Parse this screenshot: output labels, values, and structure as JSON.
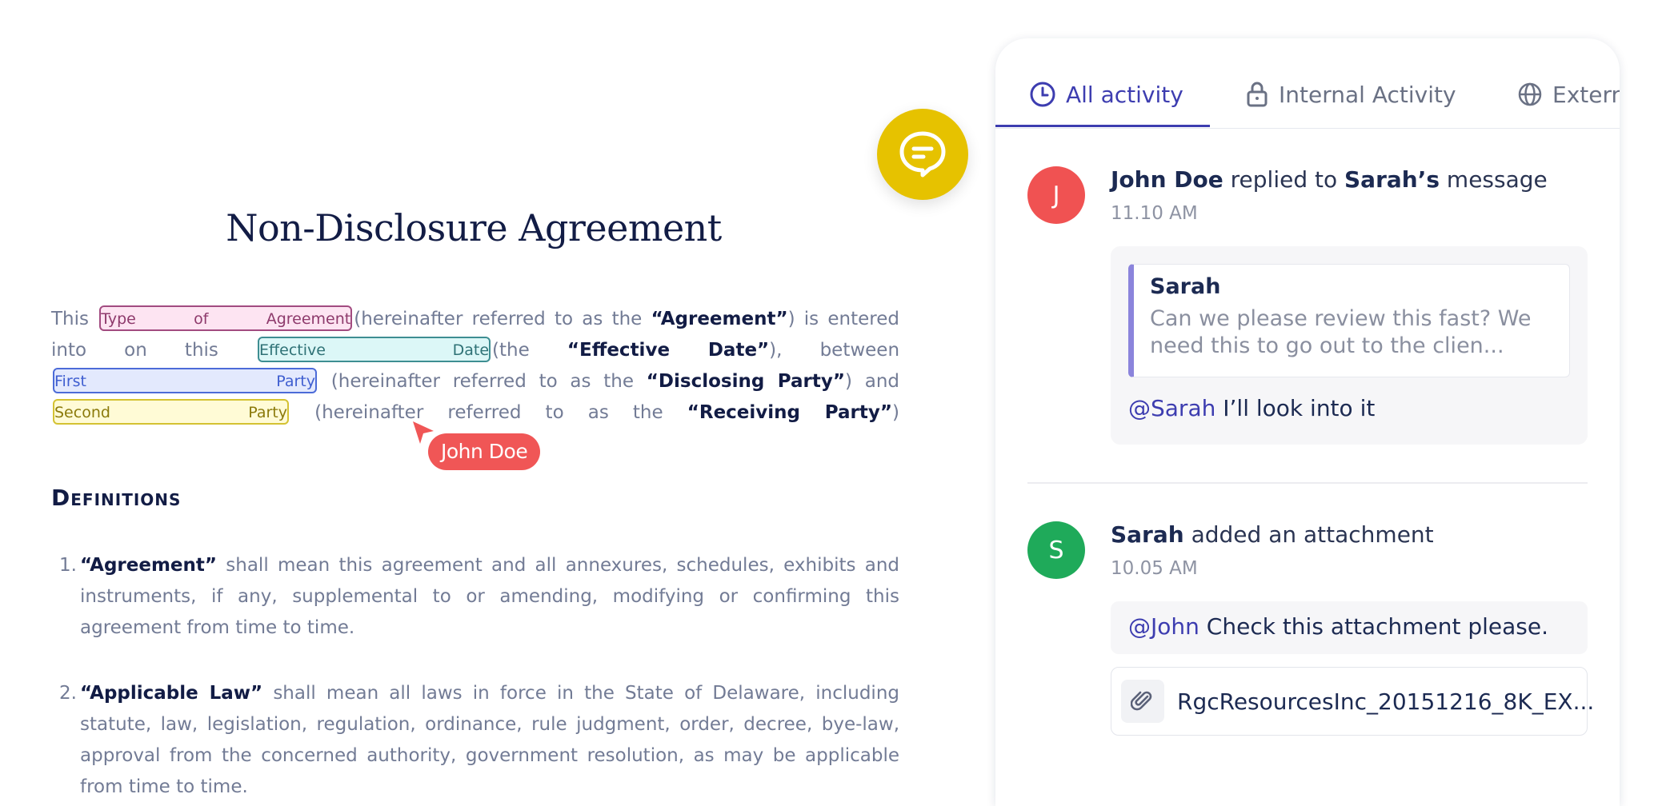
{
  "document": {
    "title": "Non-Disclosure Agreement",
    "intro": {
      "t1": "This",
      "field_type": "Type of Agreement",
      "t2": "(hereinafter referred to as the",
      "b_agreement": "“Agreement”",
      "t3": ") is entered into on this",
      "field_date": "Effective Date",
      "t4": "(the",
      "b_effective": "“Effective Date”",
      "t5": "), between",
      "field_first": "First Party",
      "t6": "(hereinafter referred to as the",
      "b_disclosing": "“Disclosing Party”",
      "t7": ") and",
      "field_second": "Second Party",
      "t8": "(hereinafter referred to as the",
      "b_receiving": "“Receiving Party”",
      "t9": ")"
    },
    "cursor": {
      "label": "John Doe",
      "color": "#f05656"
    },
    "definitions": {
      "heading": "Definitions",
      "items": [
        {
          "num": "1.",
          "term": "“Agreement”",
          "text": " shall mean this agreement and all annexures, schedules, exhibits and instruments, if any, supplemental to or amending, modifying or confirming this agreement from time to time."
        },
        {
          "num": "2.",
          "term": "“Applicable Law”",
          "text": " shall mean all laws in force in the State of Delaware, including statute, law, legislation, regulation, ordinance, rule judgment, order, decree, bye-law, approval from the concerned authority, government resolution, as may be applicable from time to time."
        }
      ]
    }
  },
  "chat_button": {
    "icon": "chat-bubble-icon",
    "color": "#e6c200"
  },
  "activity": {
    "tabs": [
      {
        "label": "All activity",
        "icon": "clock-icon",
        "active": true
      },
      {
        "label": "Internal Activity",
        "icon": "lock-icon"
      },
      {
        "label": "Extern",
        "icon": "globe-icon"
      }
    ],
    "items": [
      {
        "avatar": "J",
        "avatar_color": "#f05252",
        "actor": "John Doe",
        "action": " replied to ",
        "target": "Sarah’s",
        "suffix": " message",
        "time": "11.10 AM",
        "quote_author": "Sarah",
        "quote_text": "Can we please review this fast? We need this to go out to the clien...",
        "reply_mention": "@Sarah",
        "reply_text": " I’ll look into it"
      },
      {
        "avatar": "S",
        "avatar_color": "#1faa5a",
        "actor": "Sarah",
        "action": " added an attachment",
        "time": "10.05 AM",
        "msg_mention": "@John",
        "msg_text": " Check this attachment please.",
        "attachment_icon": "paperclip-icon",
        "attachment_name": "RgcResourcesInc_20151216_8K_EX..."
      }
    ]
  }
}
